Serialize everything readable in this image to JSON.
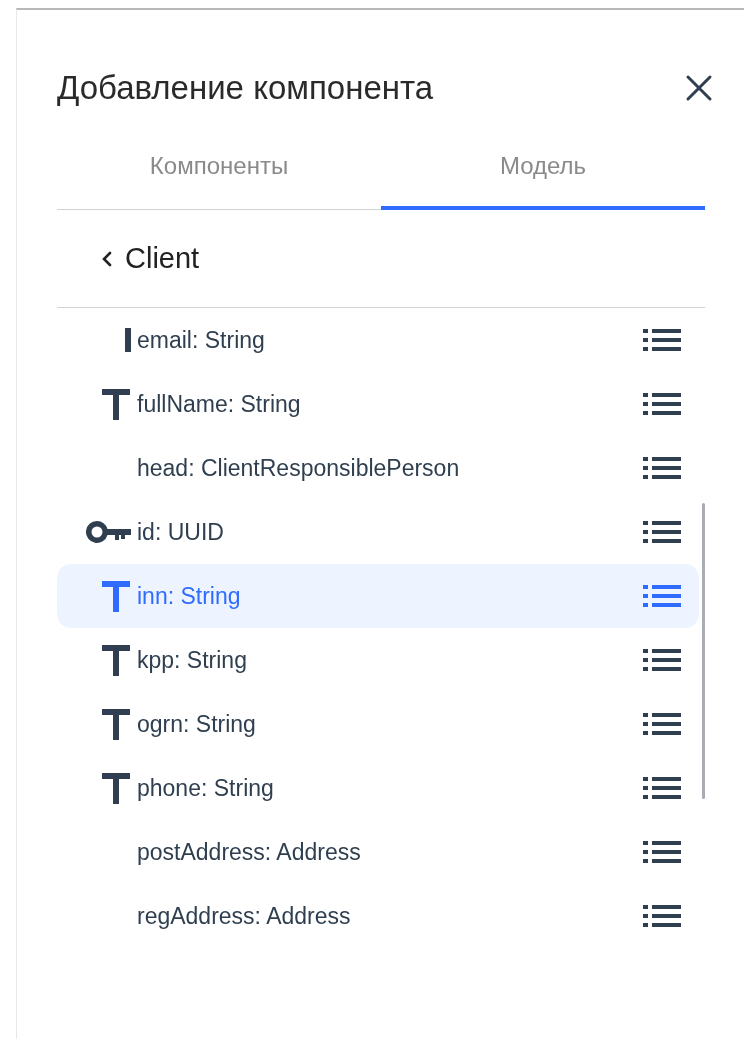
{
  "dialog": {
    "title": "Добавление компонента"
  },
  "tabs": [
    {
      "label": "Компоненты",
      "selected": false
    },
    {
      "label": "Модель",
      "selected": true
    }
  ],
  "breadcrumb": {
    "label": "Client"
  },
  "fields": [
    {
      "label": "email: String",
      "kind": "stem",
      "selected": false
    },
    {
      "label": "fullName: String",
      "kind": "text",
      "selected": false
    },
    {
      "label": "head: ClientResponsiblePerson",
      "kind": "none",
      "selected": false
    },
    {
      "label": "id: UUID",
      "kind": "key",
      "selected": false
    },
    {
      "label": "inn: String",
      "kind": "text",
      "selected": true
    },
    {
      "label": "kpp: String",
      "kind": "text",
      "selected": false
    },
    {
      "label": "ogrn: String",
      "kind": "text",
      "selected": false
    },
    {
      "label": "phone: String",
      "kind": "text",
      "selected": false
    },
    {
      "label": "postAddress: Address",
      "kind": "none",
      "selected": false
    },
    {
      "label": "regAddress: Address",
      "kind": "none",
      "selected": false
    }
  ]
}
